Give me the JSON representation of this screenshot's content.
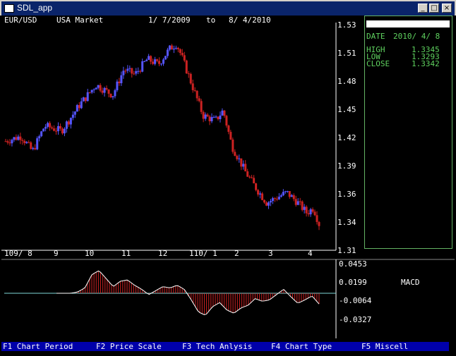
{
  "window": {
    "title": "SDL_app"
  },
  "chart": {
    "pair": "EUR/USD",
    "market": "USA Market",
    "date_from": "1/ 7/2009",
    "to": "to",
    "date_to": "8/ 4/2010"
  },
  "info": {
    "date_label": "DATE",
    "date_value": "2010/ 4/ 8",
    "high_label": "HIGH",
    "high_value": "1.3345",
    "low_label": "LOW",
    "low_value": "1.3293",
    "close_label": "CLOSE",
    "close_value": "1.3342"
  },
  "macd": {
    "label": "MACD"
  },
  "function_keys": [
    "F1 Chart Period",
    "F2 Price Scale",
    "F3 Tech Anlysis",
    "F4 Chart Type",
    "F5 Miscell"
  ],
  "colors": {
    "up": "#5555ff",
    "down": "#cc2222",
    "panel_border": "#64b464",
    "info_text": "#5fd25f",
    "fkey_bar": "#0000aa"
  },
  "chart_data": [
    {
      "type": "candlestick",
      "y_ticks": [
        "1.53",
        "1.51",
        "1.48",
        "1.45",
        "1.42",
        "1.39",
        "1.36",
        "1.34",
        "1.31"
      ],
      "x_ticks": [
        "109/ 8",
        "9",
        "10",
        "11",
        "12",
        "110/ 1",
        "2",
        "3",
        "4"
      ],
      "ylim": [
        1.31,
        1.53
      ],
      "close_path": [
        [
          "2009-07-01",
          1.415
        ],
        [
          "2009-07-15",
          1.42
        ],
        [
          "2009-07-25",
          1.405
        ],
        [
          "2009-08-05",
          1.43
        ],
        [
          "2009-08-20",
          1.425
        ],
        [
          "2009-09-05",
          1.45
        ],
        [
          "2009-09-20",
          1.47
        ],
        [
          "2009-10-05",
          1.46
        ],
        [
          "2009-10-15",
          1.485
        ],
        [
          "2009-10-25",
          1.48
        ],
        [
          "2009-11-05",
          1.495
        ],
        [
          "2009-11-15",
          1.49
        ],
        [
          "2009-11-25",
          1.505
        ],
        [
          "2009-12-01",
          1.51
        ],
        [
          "2009-12-05",
          1.5
        ],
        [
          "2009-12-15",
          1.47
        ],
        [
          "2009-12-25",
          1.44
        ],
        [
          "2010-01-05",
          1.435
        ],
        [
          "2010-01-12",
          1.445
        ],
        [
          "2010-01-20",
          1.41
        ],
        [
          "2010-02-01",
          1.385
        ],
        [
          "2010-02-10",
          1.37
        ],
        [
          "2010-02-20",
          1.355
        ],
        [
          "2010-03-01",
          1.36
        ],
        [
          "2010-03-10",
          1.365
        ],
        [
          "2010-03-20",
          1.355
        ],
        [
          "2010-03-28",
          1.345
        ],
        [
          "2010-04-03",
          1.35
        ],
        [
          "2010-04-08",
          1.3342
        ]
      ],
      "selected_candle": {
        "date": "2010/ 4/ 8",
        "high": 1.3345,
        "low": 1.3293,
        "close": 1.3342
      }
    },
    {
      "type": "histogram",
      "name": "MACD",
      "y_ticks": [
        "0.0453",
        "0.0199",
        "-0.0064",
        "-0.0327"
      ],
      "ylim": [
        -0.045,
        0.05
      ],
      "values": [
        0,
        0,
        0,
        0.002,
        0.008,
        0.028,
        0.034,
        0.022,
        0.01,
        0.018,
        0.02,
        0.012,
        0.006,
        -0.002,
        0.004,
        0.01,
        0.008,
        0.012,
        0.006,
        -0.01,
        -0.028,
        -0.033,
        -0.02,
        -0.014,
        -0.025,
        -0.03,
        -0.022,
        -0.018,
        -0.008,
        -0.012,
        -0.01,
        -0.002,
        0.006,
        -0.005,
        -0.015,
        -0.01,
        -0.004,
        -0.016
      ]
    }
  ]
}
